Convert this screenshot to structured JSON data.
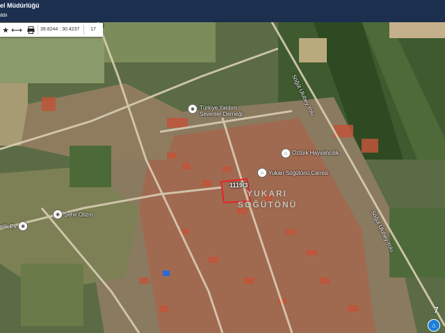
{
  "header": {
    "title": "el Müdürlüğü",
    "subtitle": "ası"
  },
  "toolbar": {
    "star_icon": "star-icon",
    "measure_icon": "ruler-icon",
    "print_icon": "printer-icon",
    "coordinates": "39.8244 : 30.4237",
    "zoom_level": "17"
  },
  "map": {
    "pois": [
      {
        "name": "Türkiye Yardım Sevenler Derneği",
        "line1": "Türkiye Yardım",
        "line2": "Sevenler Derneği"
      },
      {
        "name": "Öztürk Hayvancılık",
        "line1": "Öztürk Hayvancılık",
        "line2": ""
      },
      {
        "name": "Yukarı Söğütönü Camisi",
        "line1": "Yukarı Söğütönü Camisi",
        "line2": ""
      },
      {
        "name": "Şehir Otizm",
        "line1": "Şehir Otizm",
        "line2": ""
      },
      {
        "name": "elik Ev",
        "line1": "elik Ev",
        "line2": ""
      }
    ],
    "parcel_label": "1119/3",
    "area_label_line1": "YUKARI",
    "area_label_line2": "SÖĞÜTÖNÜ",
    "road_label_1": "Söğüt Ulubey Yolu",
    "road_label_2": "Söğüt Ulubey Yolu",
    "corner_number": "7"
  }
}
